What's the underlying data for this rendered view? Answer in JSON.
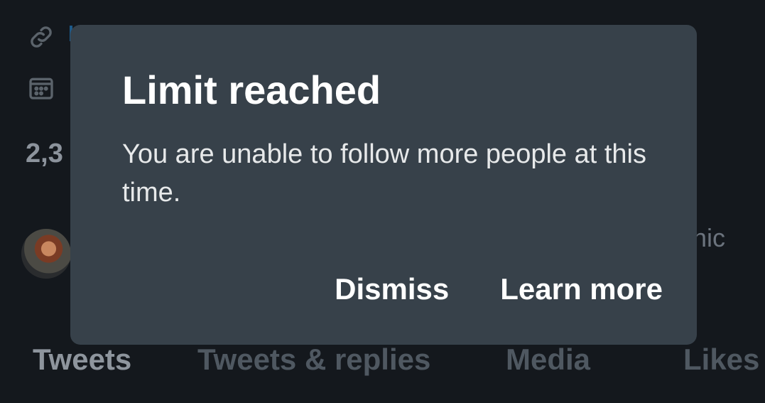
{
  "background": {
    "link_icon": "link-icon",
    "calendar_icon": "calendar-icon",
    "stat_peek": "2,3",
    "mutual_peek": "nic",
    "tabs": [
      {
        "label": "Tweets",
        "active": true
      },
      {
        "label": "Tweets & replies",
        "active": false
      },
      {
        "label": "Media",
        "active": false
      },
      {
        "label": "Likes",
        "active": false
      }
    ]
  },
  "dialog": {
    "title": "Limit reached",
    "body": "You are unable to follow more people at this time.",
    "dismiss_label": "Dismiss",
    "learn_more_label": "Learn more"
  },
  "colors": {
    "page_bg": "#14181d",
    "dialog_bg": "#37414a",
    "text_primary": "#ffffff"
  }
}
